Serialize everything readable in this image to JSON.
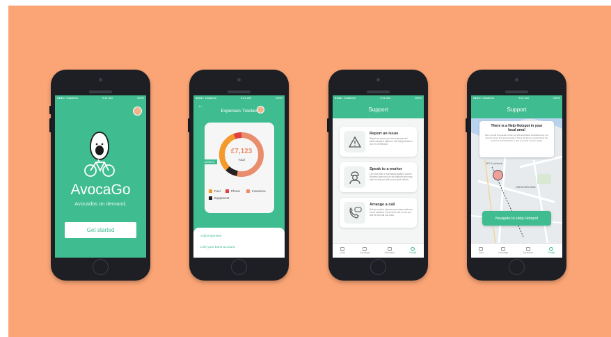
{
  "phone1": {
    "app_name": "AvocaGo",
    "tagline": "Avocados on demand.",
    "cta_label": "Get started",
    "status_left": "●●●●○ Vodafone",
    "status_time": "9:41 AM",
    "status_right": "100%"
  },
  "phone2": {
    "title": "Expenses Tracker",
    "back_icon": "back-arrow-icon",
    "total_amount": "£7,123",
    "total_label": "Total",
    "callout_amount": "£2756.74",
    "legend": [
      {
        "label": "Fuel",
        "color": "#f59a2a"
      },
      {
        "label": "Phone",
        "color": "#e0413f"
      },
      {
        "label": "Insurance",
        "color": "#e98d6d"
      },
      {
        "label": "Equipment",
        "color": "#222222"
      }
    ],
    "links": [
      "Add expenses",
      "Link your bank account"
    ],
    "status_left": "●●●●○ Vodafone",
    "status_time": "9:41 AM",
    "status_right": "100%"
  },
  "phone3": {
    "title": "Support",
    "cards": [
      {
        "title": "Report an issue",
        "desc": "Report an issue you have experienced while using the platform. We will get back to you if it is relevant.",
        "icon": "warning-icon"
      },
      {
        "title": "Speak to a worker",
        "desc": "Live chat with a nominated platform worker. Workers may work on the platform and may able to help you with some quick advice.",
        "icon": "worker-icon"
      },
      {
        "title": "Arrange a call",
        "desc": "Set up a call to discuss more issue with one of our advisors. Find a time slot to suit you and we will call you back.",
        "icon": "phone-call-icon"
      }
    ],
    "tabs": [
      "Jobs",
      "Earnings",
      "Schedule",
      "Profile"
    ],
    "status_left": "●●●●○ Vodafone",
    "status_time": "9:41 AM",
    "status_right": "100%"
  },
  "phone4": {
    "title": "Support",
    "popup_title": "There is a Help Hotspot in your local area!",
    "popup_body": "Here you will find people to help you with application troubleshooting, any account issues and general support. There will also be people giving free careers & financial advice to help you reach long term goals.",
    "map_label_1": "ODEON BFI IMAX",
    "map_label_2": "BFI Southbank",
    "cta_label": "Navigate to Help Hotspot",
    "tabs": [
      "Jobs",
      "Earnings",
      "Schedule",
      "Profile"
    ],
    "status_left": "●●●●○ Vodafone",
    "status_time": "9:41 AM",
    "status_right": "100%"
  },
  "colors": {
    "background": "#fba576",
    "brand_green": "#40bd90",
    "phone_body": "#1d1f24"
  }
}
